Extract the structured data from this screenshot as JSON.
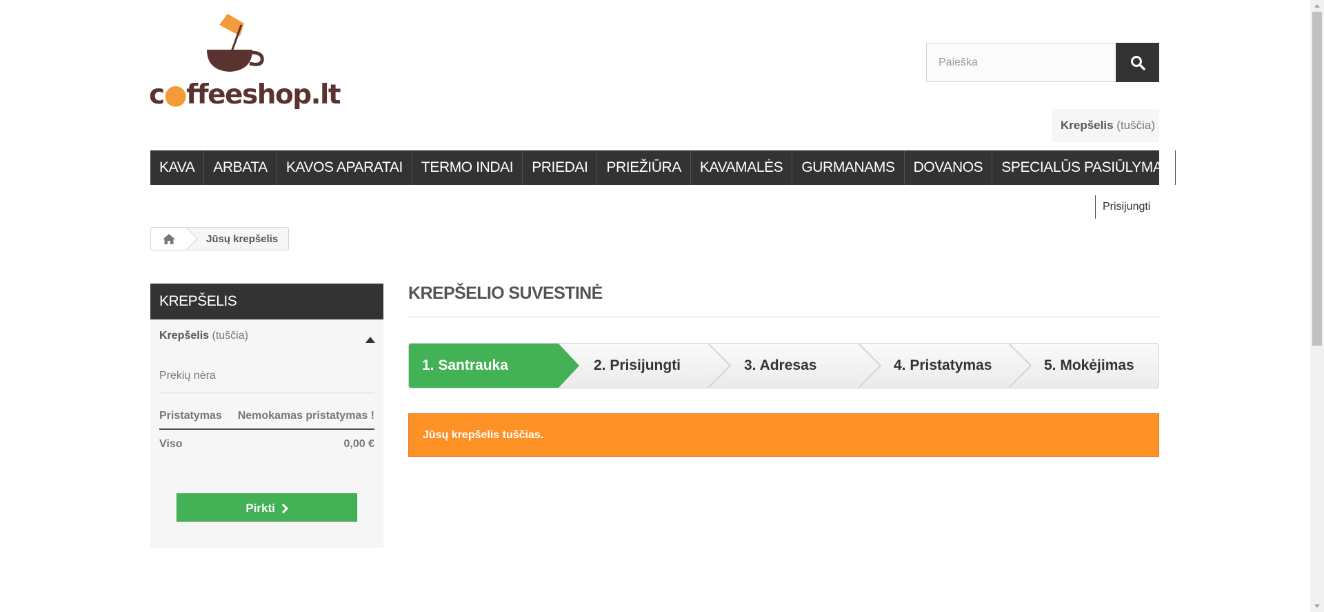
{
  "logo": {
    "text_pre": "c",
    "text_post": "ffeeshop.lt"
  },
  "search": {
    "placeholder": "Paieška"
  },
  "header_cart": {
    "label": "Krepšelis",
    "status": "(tuščia)"
  },
  "menu": {
    "items": [
      {
        "label": "KAVA"
      },
      {
        "label": "ARBATA"
      },
      {
        "label": "KAVOS APARATAI"
      },
      {
        "label": "TERMO INDAI"
      },
      {
        "label": "PRIEDAI"
      },
      {
        "label": "PRIEŽIŪRA"
      },
      {
        "label": "KAVAMALĖS"
      },
      {
        "label": "GURMANAMS"
      },
      {
        "label": "DOVANOS"
      },
      {
        "label": "SPECIALŪS PASIŪLYMAI"
      }
    ]
  },
  "user": {
    "login_label": "Prisijungti"
  },
  "breadcrumb": {
    "current": "Jūsų krepšelis"
  },
  "sidebar": {
    "title": "KREPŠELIS",
    "cart_label": "Krepšelis",
    "cart_status": "(tuščia)",
    "empty_text": "Prekių nėra",
    "shipping_label": "Pristatymas",
    "shipping_value": "Nemokamas pristatymas !",
    "total_label": "Viso",
    "total_value": "0,00 €",
    "buy_label": "Pirkti"
  },
  "main": {
    "title": "KREPŠELIO SUVESTINĖ",
    "steps": [
      {
        "label": "1. Santrauka",
        "active": true
      },
      {
        "label": "2. Prisijungti",
        "active": false
      },
      {
        "label": "3. Adresas",
        "active": false
      },
      {
        "label": "4. Pristatymas",
        "active": false
      },
      {
        "label": "5. Mokėjimas",
        "active": false
      }
    ],
    "alert": "Jūsų krepšelis tuščias."
  },
  "colors": {
    "dark": "#333333",
    "green": "#43b155",
    "orange": "#fe9126",
    "logo_brown": "#5a3230",
    "logo_accent": "#f39a3b"
  }
}
